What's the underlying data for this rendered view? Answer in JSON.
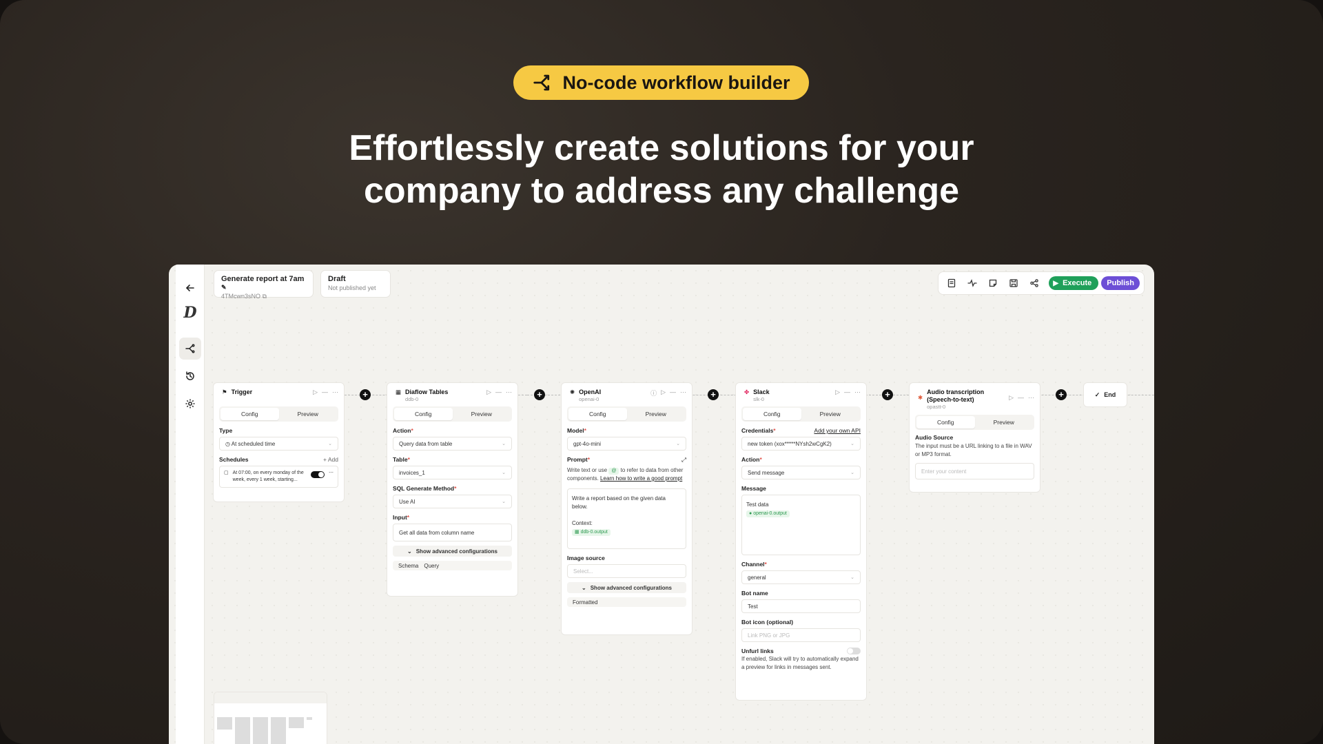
{
  "hero": {
    "badge_label": "No-code workflow builder",
    "headline_line1": "Effortlessly create solutions for your",
    "headline_line2": "company to address any challenge"
  },
  "colors": {
    "badge": "#f6c943",
    "execute": "#1fa05a",
    "publish": "#6d4fd6",
    "background": "#2a241f"
  },
  "workflow": {
    "name": "Generate report at 7am",
    "id": "4TMcwn3sNO",
    "status": "Draft",
    "status_sub": "Not published yet"
  },
  "toolbar": {
    "execute_label": "Execute",
    "publish_label": "Publish"
  },
  "tabs": {
    "config": "Config",
    "preview": "Preview"
  },
  "nodes": {
    "trigger": {
      "title": "Trigger",
      "type_label": "Type",
      "type_value": "At scheduled time",
      "schedules_label": "Schedules",
      "add_label": "Add",
      "schedule_text": "At 07:00, on every monday of the week, every 1 week, starting..."
    },
    "tables": {
      "title": "Diaflow Tables",
      "sub": "ddb-0",
      "action_label": "Action",
      "action_value": "Query data from table",
      "table_label": "Table",
      "table_value": "invoices_1",
      "sql_label": "SQL Generate Method",
      "sql_value": "Use AI",
      "input_label": "Input",
      "input_value": "Get all data from column name",
      "advanced": "Show advanced configurations",
      "schema_tab": "Schema",
      "query_tab": "Query"
    },
    "openai": {
      "title": "OpenAI",
      "sub": "openai-0",
      "model_label": "Model",
      "model_value": "gpt-4o-mini",
      "prompt_label": "Prompt",
      "prompt_desc_1": "Write text or use",
      "prompt_at": "@",
      "prompt_desc_2": "to refer to data from other components.",
      "prompt_link": "Learn how to write a good prompt",
      "prompt_text": "Write a report based on the given data below.",
      "context_label": "Context:",
      "context_pill": "ddb-0.output",
      "image_label": "Image source",
      "image_placeholder": "Select...",
      "advanced": "Show advanced configurations",
      "formatted": "Formatted"
    },
    "slack": {
      "title": "Slack",
      "sub": "slk-0",
      "cred_label": "Credentials",
      "cred_link": "Add your own API",
      "cred_value": "new token (xox*****NYsh2wCgK2)",
      "action_label": "Action",
      "action_value": "Send message",
      "message_label": "Message",
      "message_text": "Test data",
      "message_pill": "openai-0.output",
      "channel_label": "Channel",
      "channel_value": "general",
      "botname_label": "Bot name",
      "botname_value": "Test",
      "boticon_label": "Bot icon (optional)",
      "boticon_placeholder": "Link PNG or JPG",
      "unfurl_label": "Unfurl links",
      "unfurl_desc": "If enabled, Slack will try to automatically expand a preview for links in messages sent."
    },
    "audio": {
      "title": "Audio transcription (Speech-to-text)",
      "sub": "opastt-0",
      "source_label": "Audio Source",
      "source_desc": "The input must be a URL linking to a file in WAV or MP3 format.",
      "placeholder": "Enter your content"
    },
    "end": {
      "title": "End"
    }
  }
}
